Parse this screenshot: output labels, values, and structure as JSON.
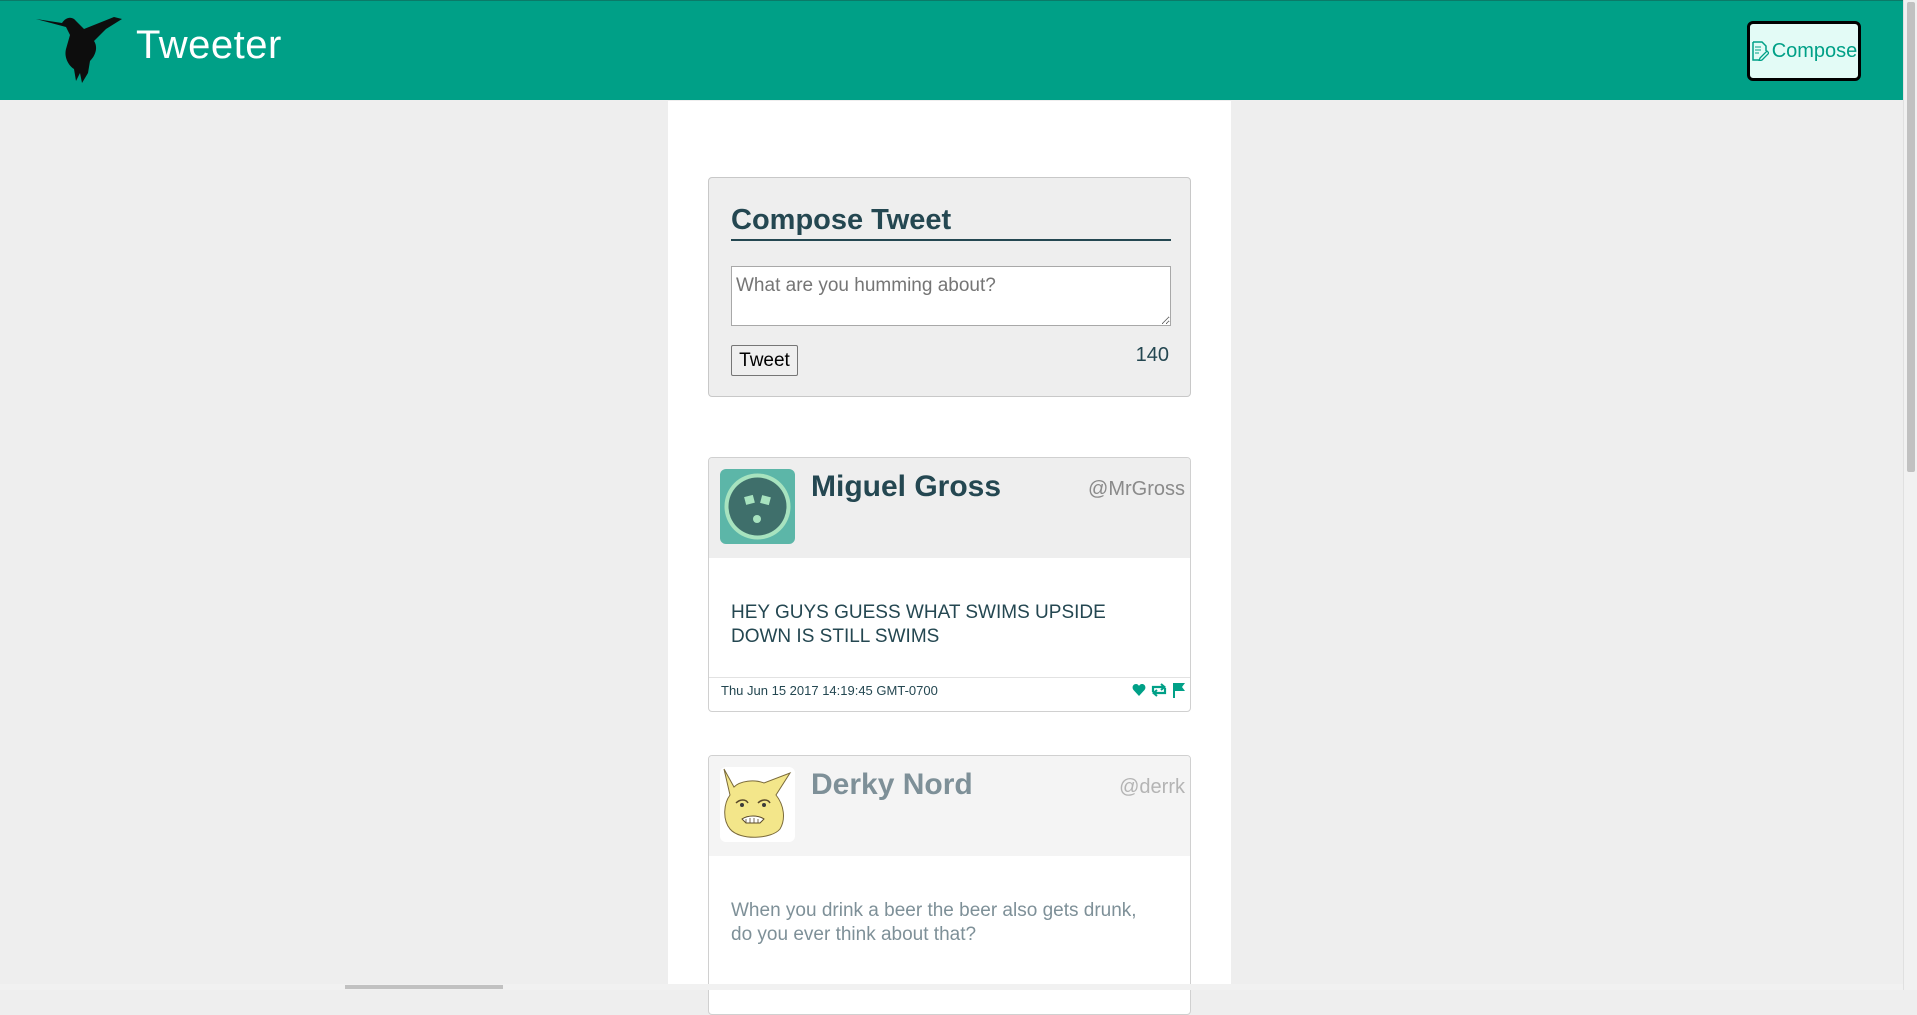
{
  "nav": {
    "brand": "Tweeter",
    "compose_label": "Compose",
    "logo_icon": "hummingbird-icon",
    "compose_icon": "compose-icon"
  },
  "new_tweet": {
    "title": "Compose Tweet",
    "placeholder": "What are you humming about?",
    "value": "",
    "submit_label": "Tweet",
    "char_count": "140"
  },
  "tweets": [
    {
      "name": "Miguel Gross",
      "handle": "@MrGross",
      "text": "HEY GUYS GUESS WHAT SWIMS UPSIDE DOWN IS STILL SWIMS",
      "date": "Thu Jun 15 2017 14:19:45 GMT-0700",
      "avatar_icon": "robot-face-avatar",
      "actions": [
        "heart-icon",
        "retweet-icon",
        "flag-icon"
      ]
    },
    {
      "name": "Derky Nord",
      "handle": "@derrk",
      "text": "When you drink a beer the beer also gets drunk, do you ever think about that?",
      "avatar_icon": "cartoon-face-avatar"
    }
  ],
  "colors": {
    "brand": "#00a087",
    "text_dark": "#244751",
    "background": "#eeeeee"
  }
}
